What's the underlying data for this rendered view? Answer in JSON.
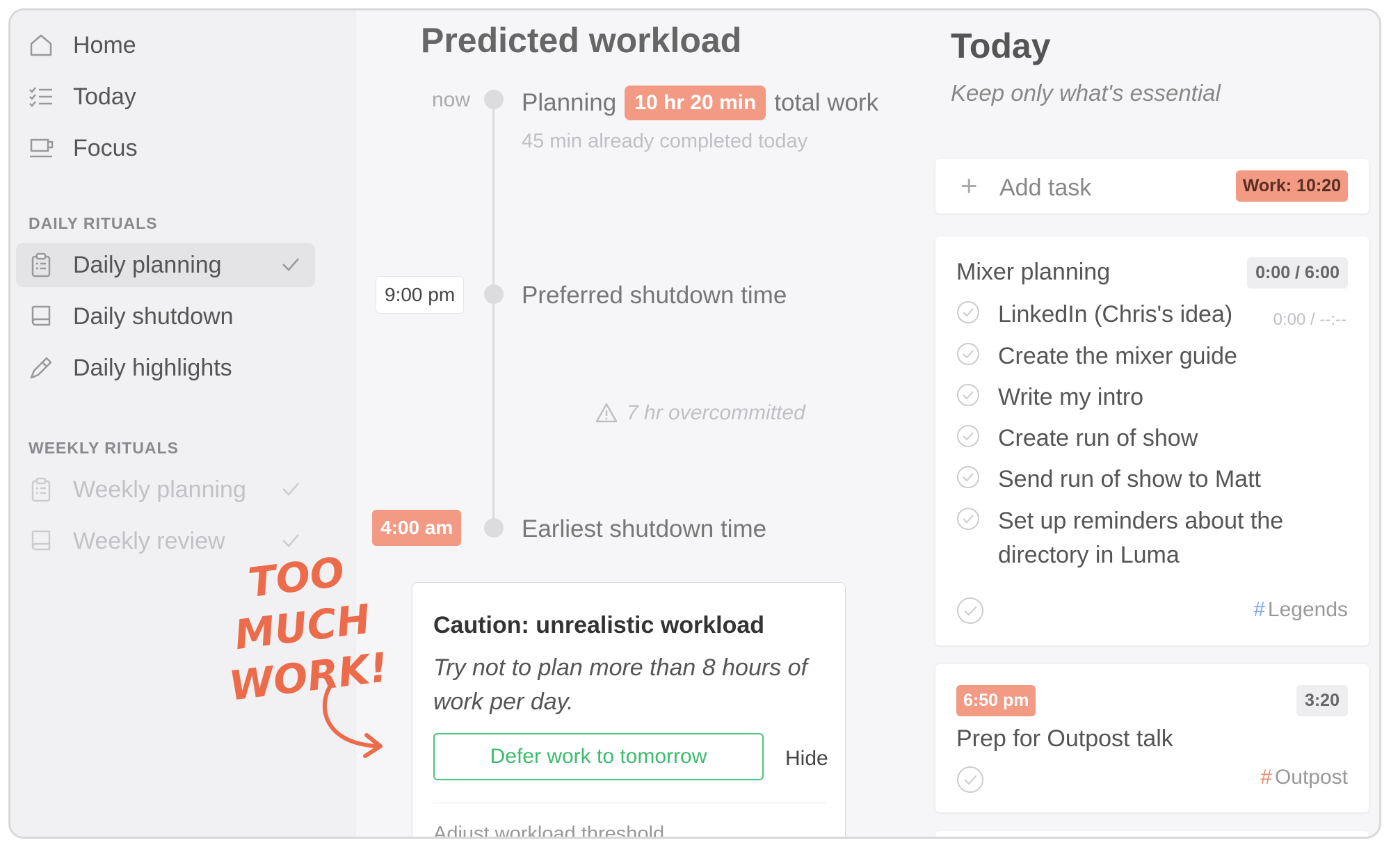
{
  "sidebar": {
    "nav": [
      {
        "label": "Home",
        "icon": "home-icon"
      },
      {
        "label": "Today",
        "icon": "list-icon"
      },
      {
        "label": "Focus",
        "icon": "coffee-cup-icon"
      }
    ],
    "daily_title": "DAILY RITUALS",
    "daily": [
      {
        "label": "Daily planning",
        "icon": "clipboard-icon",
        "selected": true,
        "checked": true
      },
      {
        "label": "Daily shutdown",
        "icon": "book-icon"
      },
      {
        "label": "Daily highlights",
        "icon": "pen-icon"
      }
    ],
    "weekly_title": "WEEKLY RITUALS",
    "weekly": [
      {
        "label": "Weekly planning",
        "icon": "clipboard-icon",
        "checked": true
      },
      {
        "label": "Weekly review",
        "icon": "book-icon",
        "checked": true
      }
    ],
    "annotation": "TOO MUCH WORK!"
  },
  "workload": {
    "title": "Predicted workload",
    "now_label": "now",
    "planning_prefix": "Planning",
    "planning_badge": "10 hr 20 min",
    "planning_suffix": "total work",
    "completed_note": "45 min already completed today",
    "preferred_time": "9:00 pm",
    "preferred_label": "Preferred shutdown time",
    "overcommitted": "7 hr overcommitted",
    "earliest_time": "4:00 am",
    "earliest_label": "Earliest shutdown time",
    "caution": {
      "title": "Caution: unrealistic workload",
      "body": "Try not to plan more than 8 hours of work per day.",
      "defer_label": "Defer work to tomorrow",
      "hide_label": "Hide",
      "adjust_label": "Adjust workload threshold"
    }
  },
  "today": {
    "title": "Today",
    "subtitle": "Keep only what's essential",
    "add_task": "Add task",
    "work_total": "Work: 10:20",
    "task1": {
      "title": "Mixer planning",
      "time": "0:00  /  6:00",
      "subtasks": [
        {
          "label": "LinkedIn (Chris's idea)",
          "time": "0:00  /  --:--"
        },
        {
          "label": "Create the mixer guide"
        },
        {
          "label": "Write my intro"
        },
        {
          "label": "Create run of show"
        },
        {
          "label": "Send run of show to Matt"
        },
        {
          "label": "Set up reminders about the directory in Luma"
        }
      ],
      "tag": "Legends",
      "tag_color": "#7aa7e8"
    },
    "task2": {
      "start": "6:50 pm",
      "time": "3:20",
      "title": "Prep for Outpost talk",
      "tag": "Outpost",
      "tag_color": "#f08a6c"
    }
  },
  "colors": {
    "accent_red": "#f29a84",
    "green": "#4cc37b",
    "annotation": "#ec6b4a"
  }
}
